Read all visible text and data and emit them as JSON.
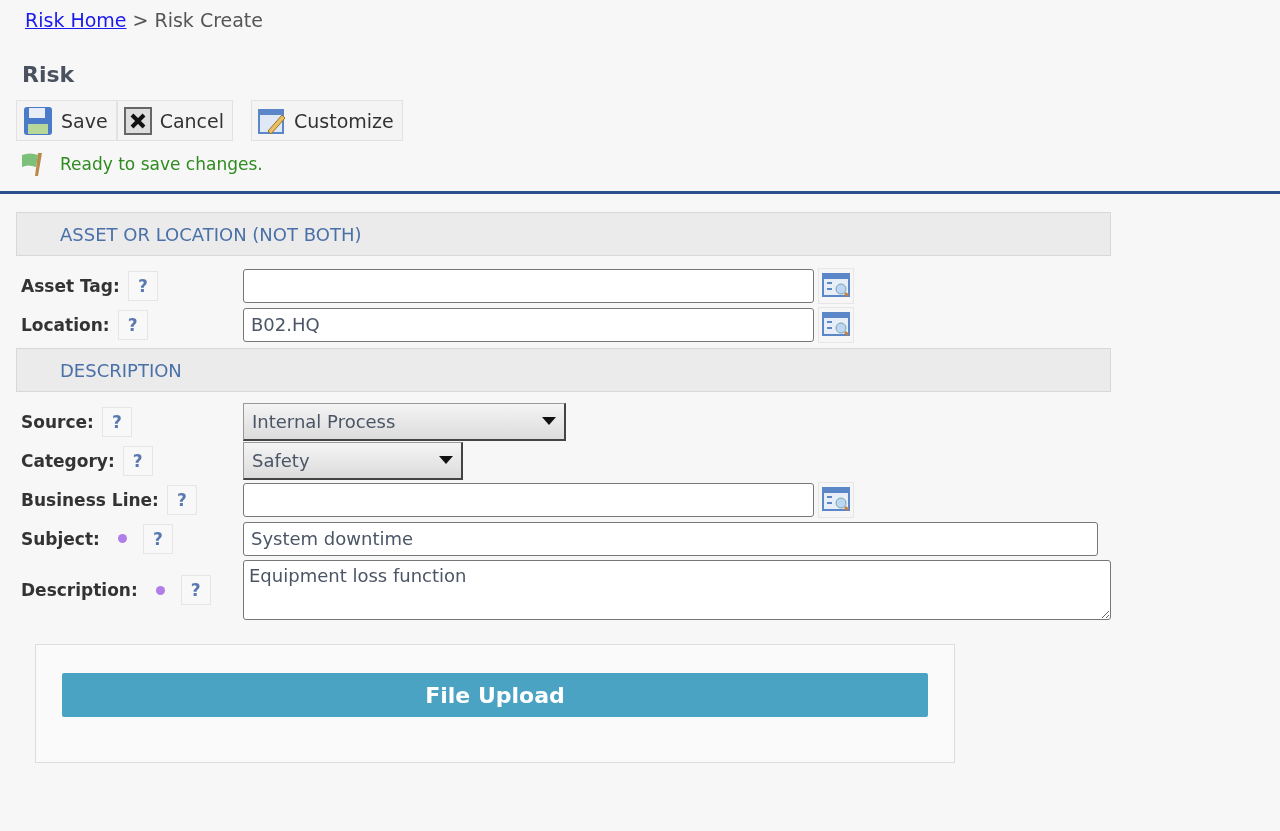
{
  "breadcrumb": {
    "link": "Risk Home",
    "separator": ">",
    "current": "Risk Create"
  },
  "title": "Risk",
  "toolbar": [
    {
      "kind": "save",
      "label": "Save"
    },
    {
      "kind": "cancel",
      "label": "Cancel"
    },
    {
      "kind": "customize",
      "label": "Customize"
    }
  ],
  "status": "Ready to save changes.",
  "sections": [
    {
      "title": "ASSET OR LOCATION (NOT BOTH)",
      "fields": [
        {
          "label": "Asset Tag:",
          "kind": "lookup",
          "required": false,
          "help": "?"
        },
        {
          "label": "Location:",
          "kind": "lookup",
          "required": false,
          "help": "?",
          "value": "B02.HQ"
        }
      ]
    },
    {
      "title": "DESCRIPTION",
      "fields": [
        {
          "label": "Source:",
          "kind": "select",
          "required": false,
          "help": "?",
          "value": "Internal Process"
        },
        {
          "label": "Category:",
          "kind": "select",
          "required": false,
          "help": "?",
          "value": "Safety"
        },
        {
          "label": "Business Line:",
          "kind": "lookup",
          "required": false,
          "help": "?"
        },
        {
          "label": "Subject:",
          "kind": "text",
          "required": true,
          "help": "?",
          "value": "System downtime"
        },
        {
          "label": "Description:",
          "kind": "textarea",
          "required": true,
          "help": "?",
          "value": "Equipment loss function"
        }
      ]
    }
  ],
  "upload_button": "File Upload"
}
